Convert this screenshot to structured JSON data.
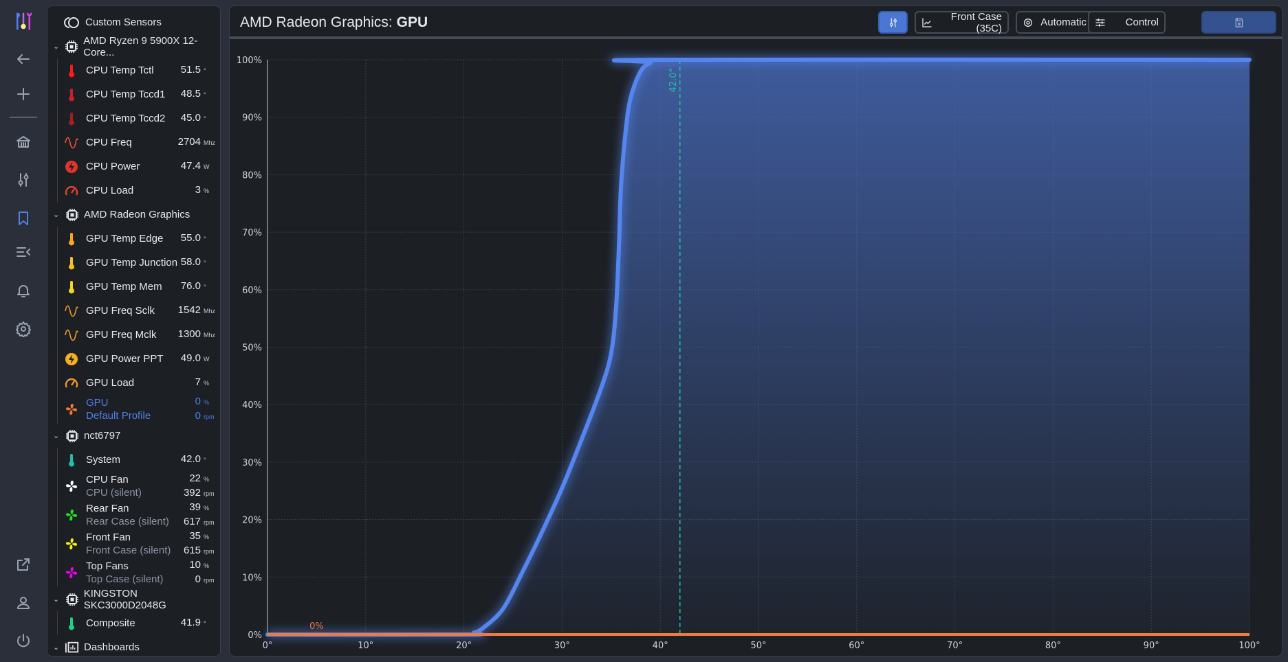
{
  "header": {
    "title_prefix": "AMD Radeon Graphics: ",
    "title_bold": "GPU",
    "buttons": {
      "profile_source": "Front Case (35C)",
      "mode": "Automatic",
      "control": "Control"
    }
  },
  "sidebar": {
    "groups": [
      {
        "name": "Custom Sensors",
        "icon": "custom-sensors-icon",
        "items": []
      },
      {
        "name": "AMD Ryzen 9 5900X 12-Core...",
        "icon": "chip-icon",
        "items": [
          {
            "label": "CPU Temp Tctl",
            "value": "51.5",
            "unit": "°",
            "icon": "thermometer",
            "color": "#ff1a1a"
          },
          {
            "label": "CPU Temp Tccd1",
            "value": "48.5",
            "unit": "°",
            "icon": "thermometer",
            "color": "#c8202a"
          },
          {
            "label": "CPU Temp Tccd2",
            "value": "45.0",
            "unit": "°",
            "icon": "thermometer",
            "color": "#a81c24"
          },
          {
            "label": "CPU Freq",
            "value": "2704",
            "unit": "Mhz",
            "icon": "wave",
            "color": "#e8553b"
          },
          {
            "label": "CPU Power",
            "value": "47.4",
            "unit": "W",
            "icon": "power",
            "color": "#e0352b"
          },
          {
            "label": "CPU Load",
            "value": "3",
            "unit": "%",
            "icon": "gauge",
            "color": "#e0452b"
          }
        ]
      },
      {
        "name": "AMD Radeon Graphics",
        "icon": "chip-icon",
        "items": [
          {
            "label": "GPU Temp Edge",
            "value": "55.0",
            "unit": "°",
            "icon": "thermometer",
            "color": "#f5a623"
          },
          {
            "label": "GPU Temp Junction",
            "value": "58.0",
            "unit": "°",
            "icon": "thermometer",
            "color": "#f5c023"
          },
          {
            "label": "GPU Temp Mem",
            "value": "76.0",
            "unit": "°",
            "icon": "thermometer",
            "color": "#f5d323"
          },
          {
            "label": "GPU Freq Sclk",
            "value": "1542",
            "unit": "Mhz",
            "icon": "wave",
            "color": "#f0962a"
          },
          {
            "label": "GPU Freq Mclk",
            "value": "1300",
            "unit": "Mhz",
            "icon": "wave",
            "color": "#f0a02a"
          },
          {
            "label": "GPU Power PPT",
            "value": "49.0",
            "unit": "W",
            "icon": "power",
            "color": "#f5b022"
          },
          {
            "label": "GPU Load",
            "value": "7",
            "unit": "%",
            "icon": "gauge",
            "color": "#f0962a"
          },
          {
            "label": "GPU",
            "sub": "Default Profile",
            "value": "0",
            "unit": "%",
            "value2": "0",
            "unit2": "rpm",
            "icon": "fan",
            "color": "#f07a3a",
            "selected": true
          }
        ]
      },
      {
        "name": "nct6797",
        "icon": "chip-icon",
        "items": [
          {
            "label": "System",
            "value": "42.0",
            "unit": "°",
            "icon": "thermometer",
            "color": "#20c0a8"
          },
          {
            "label": "CPU Fan",
            "sub": "CPU (silent)",
            "value": "22",
            "unit": "%",
            "value2": "392",
            "unit2": "rpm",
            "icon": "fan",
            "color": "#ffffff"
          },
          {
            "label": "Rear Fan",
            "sub": "Rear Case (silent)",
            "value": "39",
            "unit": "%",
            "value2": "617",
            "unit2": "rpm",
            "icon": "fan",
            "color": "#22e022"
          },
          {
            "label": "Front Fan",
            "sub": "Front Case (silent)",
            "value": "35",
            "unit": "%",
            "value2": "615",
            "unit2": "rpm",
            "icon": "fan",
            "color": "#f5f500"
          },
          {
            "label": "Top Fans",
            "sub": "Top Case (silent)",
            "value": "10",
            "unit": "%",
            "value2": "0",
            "unit2": "rpm",
            "icon": "fan",
            "color": "#f000f0"
          }
        ]
      },
      {
        "name": "KINGSTON SKC3000D2048G",
        "icon": "chip-icon",
        "items": [
          {
            "label": "Composite",
            "value": "41.9",
            "unit": "°",
            "icon": "thermometer",
            "color": "#20d080"
          }
        ]
      },
      {
        "name": "Dashboards",
        "icon": "dashboard-icon",
        "items": []
      }
    ]
  },
  "colors": {
    "curve": "#5585ee",
    "fan_duty": "#ee7a45",
    "marker": "#20c0b0",
    "accent": "#4a76d4",
    "save": "#34528f"
  },
  "chart_data": {
    "type": "line",
    "xlabel": "",
    "ylabel": "",
    "xlim": [
      0,
      100
    ],
    "ylim": [
      0,
      100
    ],
    "x_ticks": [
      "0°",
      "10°",
      "20°",
      "30°",
      "40°",
      "50°",
      "60°",
      "70°",
      "80°",
      "90°",
      "100°"
    ],
    "y_ticks": [
      "0%",
      "10%",
      "20%",
      "30%",
      "40%",
      "50%",
      "60%",
      "70%",
      "80%",
      "90%",
      "100%"
    ],
    "grid": true,
    "series": [
      {
        "name": "fan-curve",
        "points": [
          [
            0,
            0
          ],
          [
            20,
            0
          ],
          [
            21,
            0.3
          ],
          [
            22,
            1.2
          ],
          [
            24,
            4.5
          ],
          [
            26,
            11
          ],
          [
            28,
            18
          ],
          [
            30,
            25.5
          ],
          [
            32,
            34
          ],
          [
            34,
            43
          ],
          [
            35,
            49
          ],
          [
            35.5,
            57
          ],
          [
            35.8,
            68
          ],
          [
            36,
            78
          ],
          [
            36.5,
            88
          ],
          [
            37,
            93.5
          ],
          [
            38,
            98
          ],
          [
            39,
            99.5
          ],
          [
            40,
            100
          ],
          [
            100,
            100
          ]
        ]
      },
      {
        "name": "current-duty",
        "points": [
          [
            0,
            0
          ],
          [
            100,
            0
          ]
        ],
        "label": "0%",
        "label_at": 5
      }
    ],
    "marker": {
      "x": 42.0,
      "label": "42.0°"
    }
  }
}
